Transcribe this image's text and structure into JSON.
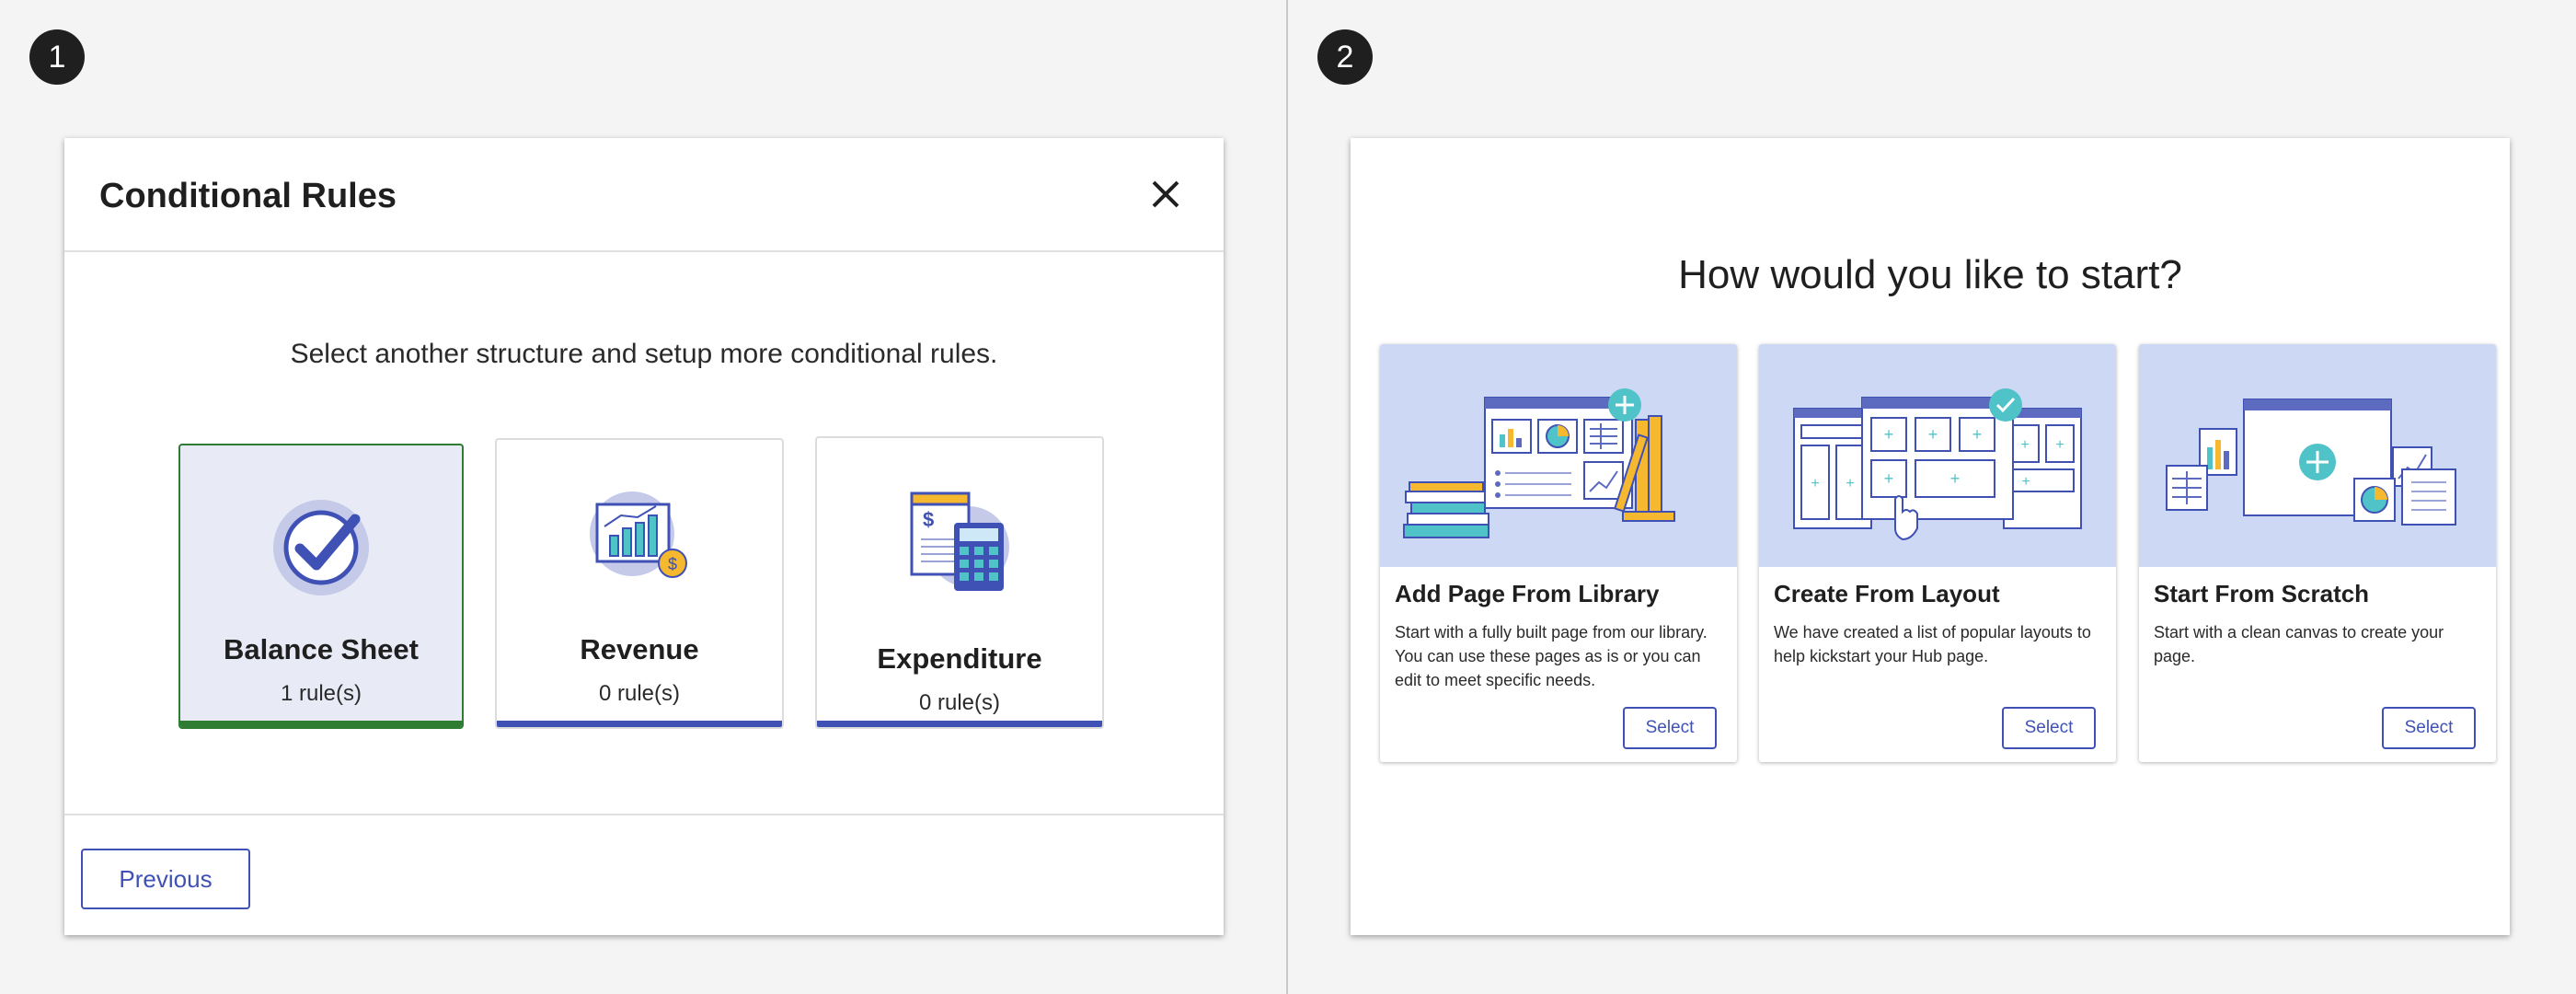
{
  "steps": [
    "1",
    "2"
  ],
  "conditional_rules": {
    "title": "Conditional Rules",
    "subtitle": "Select another structure and setup more conditional rules.",
    "cards": [
      {
        "title": "Balance Sheet",
        "rules": "1 rule(s)",
        "icon": "checkmark-icon",
        "selected": true
      },
      {
        "title": "Revenue",
        "rules": "0 rule(s)",
        "icon": "revenue-chart-icon",
        "selected": false
      },
      {
        "title": "Expenditure",
        "rules": "0 rule(s)",
        "icon": "calculator-icon",
        "selected": false
      }
    ],
    "previous_label": "Previous"
  },
  "start_options": {
    "heading": "How would you like to start?",
    "options": [
      {
        "title": "Add Page From Library",
        "description": "Start with a fully built page from our library. You can use these pages as is or you can edit to meet specific needs.",
        "select_label": "Select"
      },
      {
        "title": "Create From Layout",
        "description": "We have created a list of popular layouts to help kickstart your Hub page.",
        "select_label": "Select"
      },
      {
        "title": "Start From Scratch",
        "description": "Start with a clean canvas to create your page.",
        "select_label": "Select"
      }
    ]
  },
  "colors": {
    "accent": "#3f51b5",
    "selected": "#2e7d32",
    "selected_bg": "#e8eaf6",
    "illustration_bg": "#cdd8f4",
    "teal": "#4fc3c7",
    "yellow": "#f5b82e"
  }
}
